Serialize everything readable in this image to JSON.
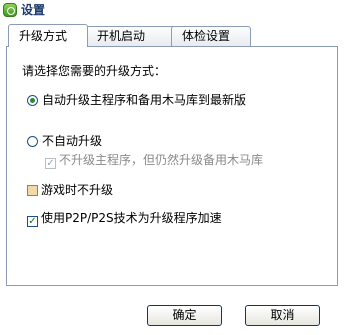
{
  "window": {
    "title": "设置"
  },
  "tabs": [
    {
      "label": "升级方式",
      "active": true
    },
    {
      "label": "开机启动",
      "active": false
    },
    {
      "label": "体检设置",
      "active": false
    }
  ],
  "content": {
    "prompt": "请选择您需要的升级方式：",
    "options": {
      "auto_upgrade": {
        "label": "自动升级主程序和备用木马库到最新版",
        "selected": true
      },
      "no_auto_upgrade": {
        "label": "不自动升级",
        "selected": false
      },
      "sub_option": {
        "label": "不升级主程序，但仍然升级备用木马库",
        "checked": true,
        "enabled": false
      },
      "no_upgrade_in_game": {
        "label": "游戏时不升级",
        "checked": false
      },
      "p2p_accelerate": {
        "label": "使用P2P/P2S技术为升级程序加速",
        "checked": true
      }
    }
  },
  "buttons": {
    "ok": "确定",
    "cancel": "取消"
  },
  "colors": {
    "title_text": "#1d3a6e",
    "tab_border": "#8c9cb4",
    "radio_dot": "#2b8a2b"
  }
}
